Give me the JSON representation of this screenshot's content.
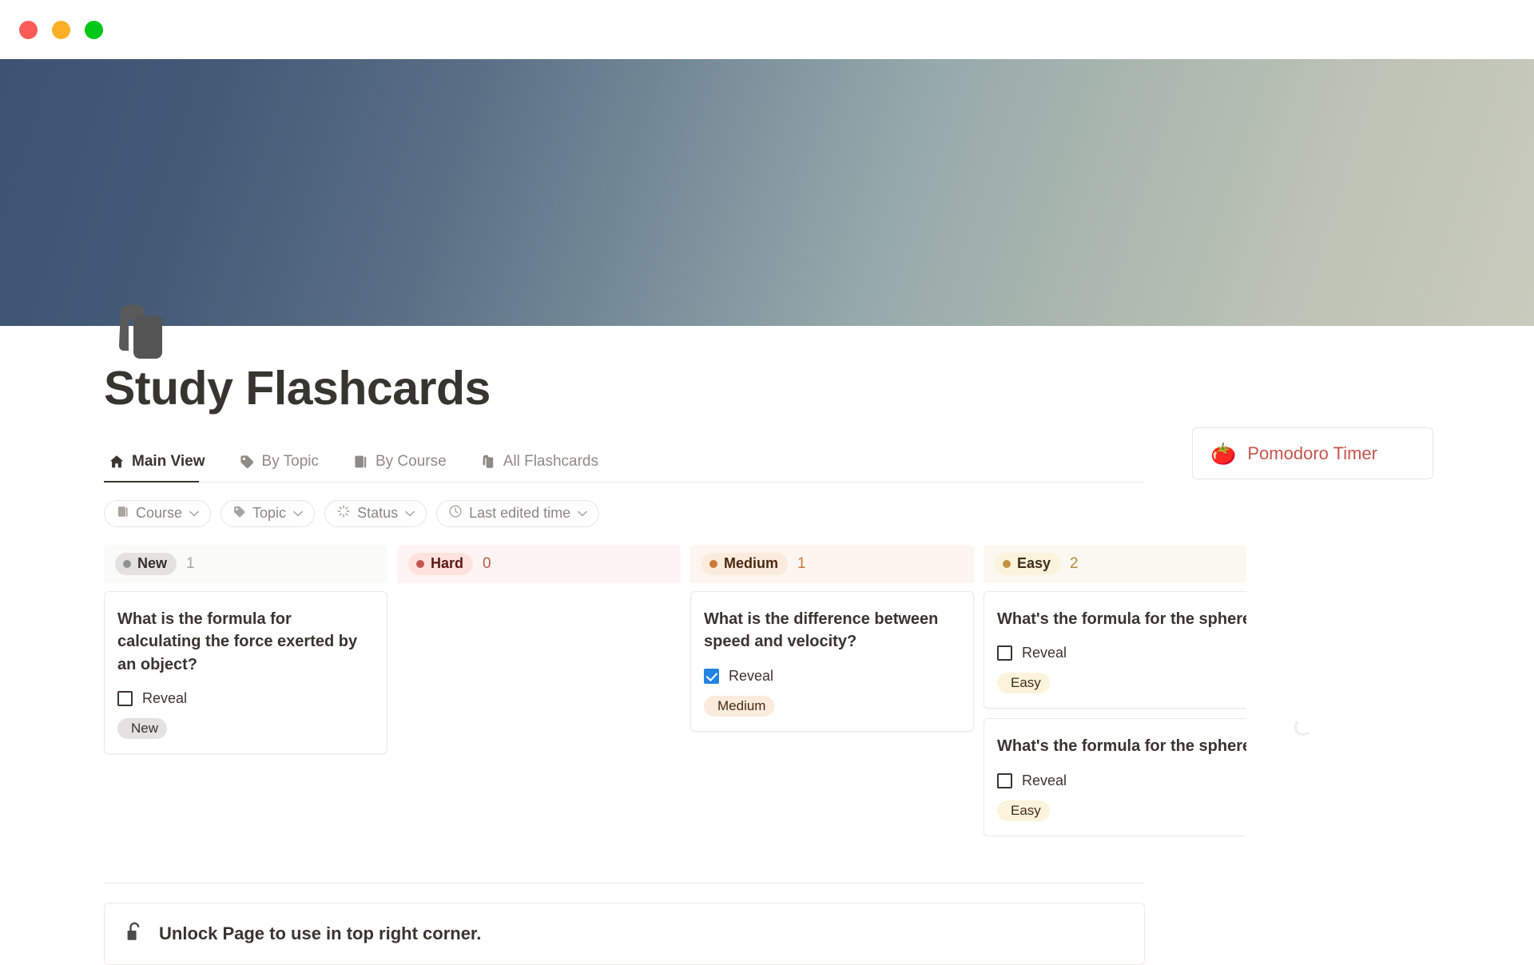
{
  "window": {
    "traffic_lights": [
      "close",
      "minimize",
      "zoom"
    ],
    "colors": {
      "close": "#fc5b57",
      "minimize": "#fdb025",
      "zoom": "#00c718"
    }
  },
  "cover": {
    "gradient_from": "#3e5372",
    "gradient_to": "#c9cbbd"
  },
  "page": {
    "icon": "flashcards-icon",
    "title": "Study Flashcards"
  },
  "tabs": [
    {
      "label": "Main View",
      "icon": "home-icon",
      "active": true
    },
    {
      "label": "By Topic",
      "icon": "tag-icon",
      "active": false
    },
    {
      "label": "By Course",
      "icon": "book-icon",
      "active": false
    },
    {
      "label": "All Flashcards",
      "icon": "cards-icon",
      "active": false
    }
  ],
  "filters": [
    {
      "label": "Course",
      "icon": "book-icon",
      "chevron": "⌄"
    },
    {
      "label": "Topic",
      "icon": "tag-icon",
      "chevron": "⌄"
    },
    {
      "label": "Status",
      "icon": "spinner-icon",
      "chevron": "⌄"
    },
    {
      "label": "Last edited time",
      "icon": "clock-icon",
      "chevron": "⌄"
    }
  ],
  "board": {
    "columns": [
      {
        "status": "New",
        "count": "1",
        "pill_bg": "#e3e2e0",
        "dot_color": "#919191",
        "cards": [
          {
            "question": "What is the formula for calculating the force exerted by an object?",
            "reveal_label": "Reveal",
            "reveal_checked": false,
            "tag": "New"
          }
        ]
      },
      {
        "status": "Hard",
        "count": "0",
        "pill_bg": "#ffe2dd",
        "dot_color": "#c4554d",
        "cards": []
      },
      {
        "status": "Medium",
        "count": "1",
        "pill_bg": "#faebdd",
        "dot_color": "#cb7b37",
        "cards": [
          {
            "question": "What is the difference between speed and velocity?",
            "reveal_label": "Reveal",
            "reveal_checked": true,
            "tag": "Medium"
          }
        ]
      },
      {
        "status": "Easy",
        "count": "2",
        "pill_bg": "#fbf3db",
        "dot_color": "#c29343",
        "cards": [
          {
            "question": "What's the formula for the sphere volume?",
            "reveal_label": "Reveal",
            "reveal_checked": false,
            "tag": "Easy"
          },
          {
            "question": "What's the formula for the sphere surface area?",
            "reveal_label": "Reveal",
            "reveal_checked": false,
            "tag": "Easy"
          }
        ]
      }
    ]
  },
  "rail": {
    "pomodoro": {
      "icon": "tomato-icon",
      "label": "Pomodoro Timer",
      "color": "#c4554d"
    },
    "loading": "loading-spinner"
  },
  "bottom": {
    "icon": "unlock-icon",
    "text": "Unlock Page to use in top right corner."
  }
}
